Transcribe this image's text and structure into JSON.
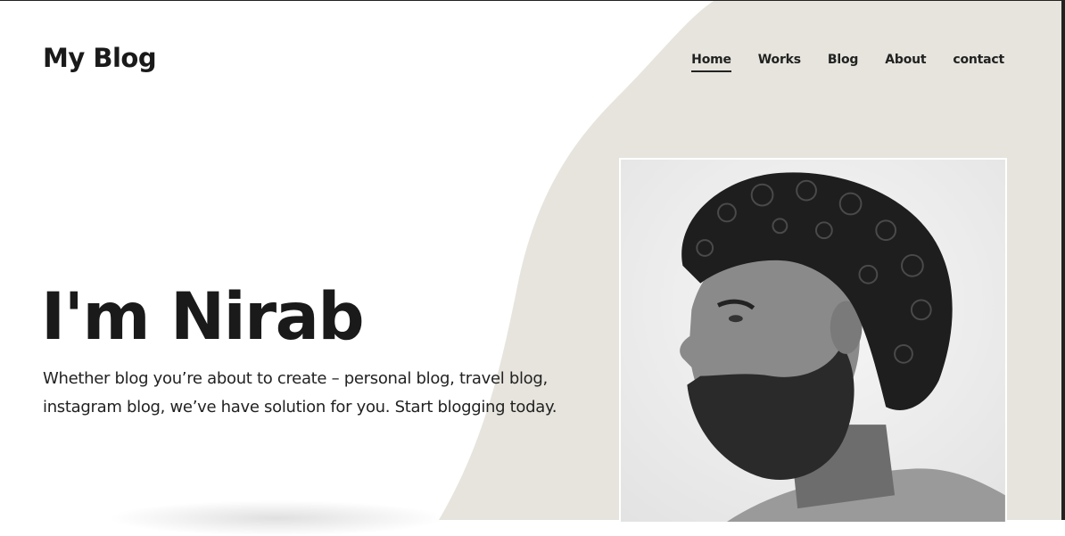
{
  "site": {
    "logo": "My Blog"
  },
  "nav": {
    "items": [
      {
        "label": "Home",
        "active": true
      },
      {
        "label": "Works",
        "active": false
      },
      {
        "label": "Blog",
        "active": false
      },
      {
        "label": "About",
        "active": false
      },
      {
        "label": "contact",
        "active": false
      }
    ]
  },
  "hero": {
    "title": "I'm Nirab",
    "text": "Whether blog you’re about to create – personal blog, travel blog, instagram blog, we’ve have solution for you. Start blogging today."
  },
  "colors": {
    "accent_shape": "#e6e4dd",
    "text": "#1a1a1a"
  }
}
